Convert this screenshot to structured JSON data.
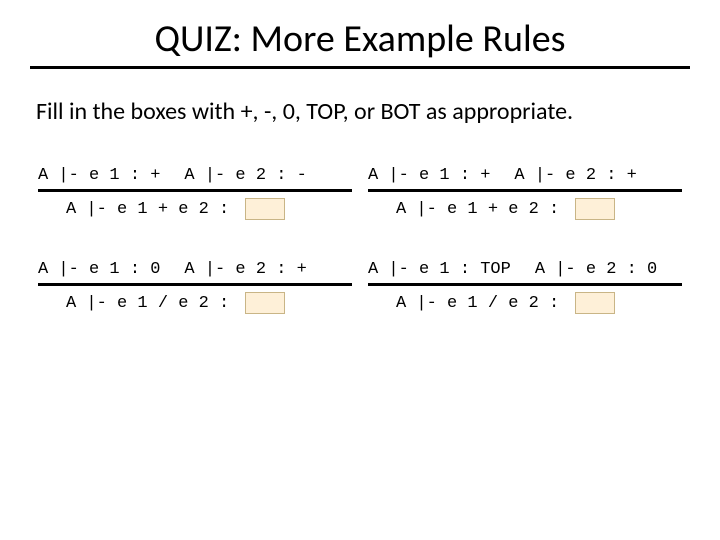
{
  "title": "QUIZ: More Example Rules",
  "instructions": "Fill in the boxes with +, -, 0, TOP, or BOT as appropriate.",
  "rules": [
    {
      "p1": "A |- e 1 : +",
      "p2": "A |- e 2 : -",
      "c": "A |- e 1 + e 2 : "
    },
    {
      "p1": "A |- e 1 : +",
      "p2": "A |- e 2 : +",
      "c": "A |- e 1 + e 2 : "
    },
    {
      "p1": "A |- e 1 : 0",
      "p2": "A |- e 2 : +",
      "c": "A |- e 1 / e 2 : "
    },
    {
      "p1": "A |- e 1 : TOP",
      "p2": "A |- e 2 : 0",
      "c": "A |- e 1 / e 2 : "
    }
  ]
}
